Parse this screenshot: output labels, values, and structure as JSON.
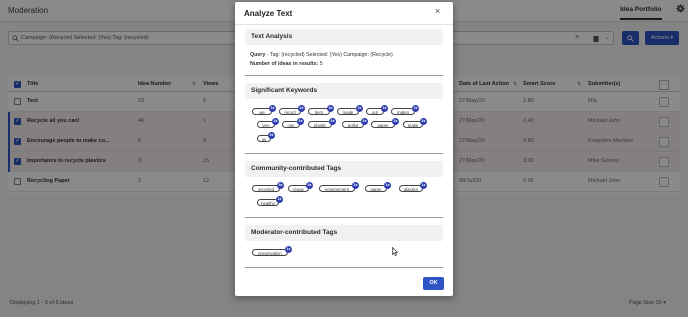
{
  "app": {
    "title": "Moderation",
    "nav_tab": "Idea Portfolio",
    "filter_text": "Campaign: (Recycle) Selected: (Yes) Tag: (recycled)",
    "actions_label": "Actions ▾",
    "footer_left": "Displaying 1 - 5 of 5 ideas",
    "footer_right": "Page Size  20 ▾"
  },
  "table": {
    "headers": {
      "title": "Title",
      "idea_number": "Idea Number",
      "views": "Views",
      "last_action": "Date of Last Action",
      "smart_score": "Smart Score",
      "submitters": "Submitter(s)"
    },
    "rows": [
      {
        "title": "Text",
        "idea_number": "53",
        "views": "5",
        "last_action": "27/May/20",
        "smart_score": "1.80",
        "submitter": "Mia",
        "selected": false
      },
      {
        "title": "Recycle all you can!",
        "idea_number": "46",
        "views": "1",
        "last_action": "27/May/20",
        "smart_score": "2.40",
        "submitter": "Michael John",
        "selected": true
      },
      {
        "title": "Encourage people to make co...",
        "idea_number": "8",
        "views": "8",
        "last_action": "27/May/20",
        "smart_score": "4.80",
        "submitter": "Forgotten Member",
        "selected": true
      },
      {
        "title": "Importance to recycle plastics",
        "idea_number": "3",
        "views": "15",
        "last_action": "27/May/20",
        "smart_score": "3.00",
        "submitter": "Mike Gomes",
        "selected": true
      },
      {
        "title": "Recycling Paper",
        "idea_number": "2",
        "views": "12",
        "last_action": "08/Jul/20",
        "smart_score": "5.95",
        "submitter": "Michael John",
        "selected": false
      }
    ]
  },
  "modal": {
    "title": "Analyze Text",
    "close_glyph": "×",
    "text_analysis": {
      "heading": "Text Analysis",
      "query_label": "Query",
      "query_value": " - Tag: (recycled) Selected: (Yes) Campaign: (Recycle)",
      "count_label": "Number of ideas in results:",
      "count_value": " 5"
    },
    "keywords": {
      "heading": "Significant Keywords",
      "items": [
        {
          "label": "we",
          "count": "2x"
        },
        {
          "label": "recycl",
          "count": "2x"
        },
        {
          "label": "item",
          "count": "2x"
        },
        {
          "label": "made",
          "count": "2x"
        },
        {
          "label": "our",
          "count": "2x"
        },
        {
          "label": "materi",
          "count": "2x"
        },
        {
          "label": "ven",
          "count": "2x"
        },
        {
          "label": "can",
          "count": "2x"
        },
        {
          "label": "plastic",
          "count": "2x"
        },
        {
          "label": "pollut",
          "count": "2x"
        },
        {
          "label": "paper",
          "count": "2x"
        },
        {
          "label": "make",
          "count": "2x"
        },
        {
          "label": "us",
          "count": "2x"
        }
      ]
    },
    "community_tags": {
      "heading": "Community-contributed Tags",
      "items": [
        {
          "label": "recycled",
          "count": "5x"
        },
        {
          "label": "reuse",
          "count": "3x"
        },
        {
          "label": "environment",
          "count": "2x"
        },
        {
          "label": "paper",
          "count": "1x"
        },
        {
          "label": "plastics",
          "count": "1x"
        },
        {
          "label": "healthy",
          "count": "1x"
        }
      ]
    },
    "moderator_tags": {
      "heading": "Moderator-contributed Tags",
      "items": [
        {
          "label": "preservation",
          "count": "1x"
        }
      ]
    },
    "ok_label": "OK"
  }
}
